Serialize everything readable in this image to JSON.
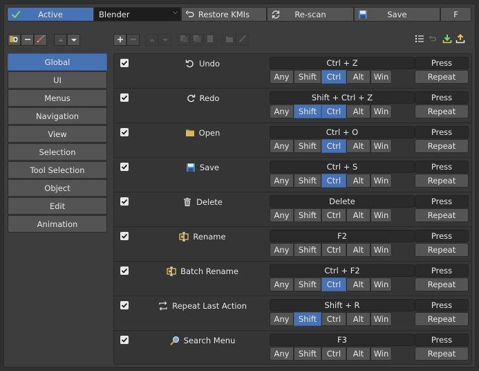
{
  "topbar": {
    "active_label": "Active",
    "preset_value": "Blender",
    "restore_label": "Restore KMIs",
    "rescan_label": "Re-scan",
    "save_label": "Save",
    "f_label": "F"
  },
  "categories": [
    {
      "label": "Global",
      "active": true
    },
    {
      "label": "UI"
    },
    {
      "label": "Menus"
    },
    {
      "label": "Navigation"
    },
    {
      "label": "View"
    },
    {
      "label": "Selection"
    },
    {
      "label": "Tool Selection"
    },
    {
      "label": "Object"
    },
    {
      "label": "Edit"
    },
    {
      "label": "Animation"
    }
  ],
  "modifier_labels": [
    "Any",
    "Shift",
    "Ctrl",
    "Alt",
    "Win"
  ],
  "items": [
    {
      "name": "Undo",
      "icon": "undo-icon",
      "enabled": true,
      "key": "Ctrl + Z",
      "event": "Press",
      "repeat": "Repeat",
      "modifiers": [
        "Ctrl"
      ]
    },
    {
      "name": "Redo",
      "icon": "redo-icon",
      "enabled": true,
      "key": "Shift + Ctrl + Z",
      "event": "Press",
      "repeat": "Repeat",
      "modifiers": [
        "Shift",
        "Ctrl"
      ]
    },
    {
      "name": "Open",
      "icon": "folder-icon",
      "enabled": true,
      "key": "Ctrl + O",
      "event": "Press",
      "repeat": "Repeat",
      "modifiers": [
        "Ctrl"
      ]
    },
    {
      "name": "Save",
      "icon": "floppy-icon",
      "enabled": true,
      "key": "Ctrl + S",
      "event": "Press",
      "repeat": "Repeat",
      "modifiers": [
        "Ctrl"
      ]
    },
    {
      "name": "Delete",
      "icon": "trash-icon",
      "enabled": true,
      "key": "Delete",
      "event": "Press",
      "repeat": "Repeat",
      "modifiers": []
    },
    {
      "name": "Rename",
      "icon": "rename-icon",
      "enabled": true,
      "key": "F2",
      "event": "Press",
      "repeat": "Repeat",
      "modifiers": []
    },
    {
      "name": "Batch Rename",
      "icon": "rename-icon",
      "enabled": true,
      "key": "Ctrl + F2",
      "event": "Press",
      "repeat": "Repeat",
      "modifiers": [
        "Ctrl"
      ]
    },
    {
      "name": "Repeat Last Action",
      "icon": "repeat-icon",
      "enabled": true,
      "key": "Shift + R",
      "event": "Press",
      "repeat": "Repeat",
      "modifiers": [
        "Shift"
      ]
    },
    {
      "name": "Search Menu",
      "icon": "search-icon",
      "enabled": true,
      "key": "F3",
      "event": "Press",
      "repeat": "Repeat",
      "modifiers": []
    }
  ],
  "colors": {
    "accent": "#4772b3",
    "button": "#545454",
    "field": "#2a2a2a",
    "background": "#303030"
  }
}
